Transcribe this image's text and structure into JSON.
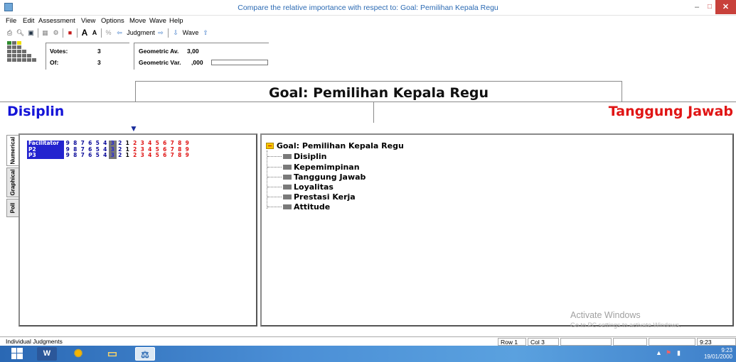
{
  "window": {
    "title": "Compare the relative importance  with respect to: Goal: Pemilihan Kepala Regu",
    "minimize": "–",
    "maximize": "□",
    "close": "✕"
  },
  "menu": [
    "File",
    "Edit",
    "Assessment",
    "View",
    "Options",
    "Move",
    "Wave",
    "Help"
  ],
  "toolbar": {
    "judgment_label": "Judgment",
    "wave_label": "Wave"
  },
  "info": {
    "votes_label": "Votes:",
    "votes_value": "3",
    "of_label": "Of:",
    "of_value": "3",
    "geo_av_label": "Geometric Av.",
    "geo_av_value": "3,00",
    "geo_var_label": "Geometric Var.",
    "geo_var_value": ",000"
  },
  "goal_title": "Goal: Pemilihan Kepala Regu",
  "left_criterion": "Disiplin",
  "right_criterion": "Tanggung Jawab",
  "side_tabs": [
    "Numerical",
    "Graphical",
    "Poll"
  ],
  "judgments": {
    "left_scale": [
      "9",
      "8",
      "7",
      "6",
      "5",
      "4",
      "3",
      "2"
    ],
    "center": "1",
    "right_scale": [
      "2",
      "3",
      "4",
      "5",
      "6",
      "7",
      "8",
      "9"
    ],
    "selected": "3",
    "rows": [
      {
        "name": "Facilitator"
      },
      {
        "name": "P2"
      },
      {
        "name": "P3"
      }
    ]
  },
  "tree": {
    "root": "Goal: Pemilihan Kepala Regu",
    "children": [
      "Disiplin",
      "Kepemimpinan",
      "Tanggung Jawab",
      "Loyalitas",
      "Prestasi Kerja",
      "Attitude"
    ]
  },
  "watermark": {
    "title": "Activate Windows",
    "subtitle": "Go to PC settings to activate Windows."
  },
  "statusbar": {
    "mode": "Individual Judgments",
    "row": "Row 1",
    "col": "Col 3",
    "time": "9:23"
  },
  "taskbar": {
    "time": "9:23",
    "date": "19/01/2000"
  },
  "colors": {
    "left_criterion": "#1414d8",
    "right_criterion": "#e01515",
    "participant_bg": "#2323cf"
  }
}
